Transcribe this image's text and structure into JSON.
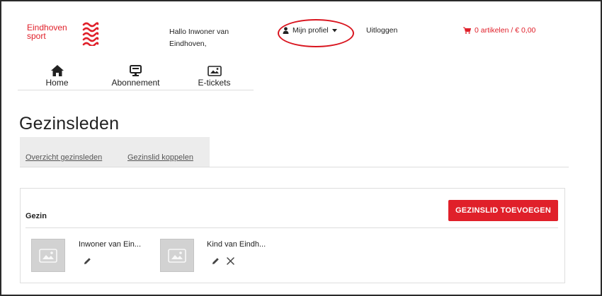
{
  "header": {
    "logo_line1": "Eindhoven",
    "logo_line2": "sport",
    "greeting_line1": "Hallo Inwoner van",
    "greeting_line2": "Eindhoven,",
    "profile_label": "Mijn profiel",
    "logout_label": "Uitloggen",
    "cart_label": "0 artikelen / € 0,00",
    "brand_color": "#e0202a"
  },
  "nav": {
    "items": [
      {
        "label": "Home",
        "icon": "home-icon"
      },
      {
        "label": "Abonnement",
        "icon": "monitor-icon"
      },
      {
        "label": "E-tickets",
        "icon": "ticket-icon"
      }
    ]
  },
  "page": {
    "title": "Gezinsleden",
    "tabs": [
      {
        "label": "Overzicht gezinsleden"
      },
      {
        "label": "Gezinslid koppelen"
      }
    ]
  },
  "panel": {
    "label": "Gezin",
    "add_button_label": "GEZINSLID TOEVOEGEN",
    "members": [
      {
        "name": "Inwoner van Ein...",
        "actions": [
          "edit-icon"
        ]
      },
      {
        "name": "Kind van Eindh...",
        "actions": [
          "edit-icon",
          "delete-icon"
        ]
      }
    ]
  }
}
